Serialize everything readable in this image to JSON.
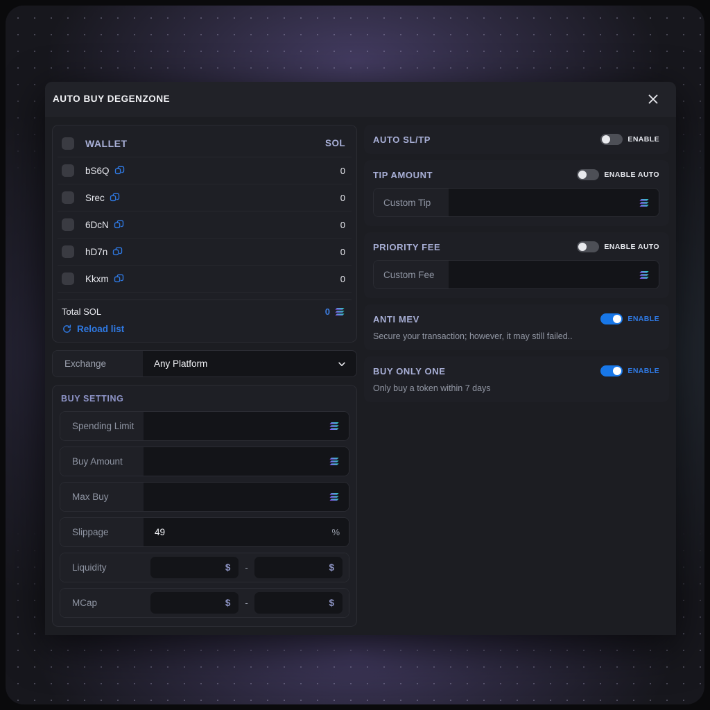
{
  "modal": {
    "title": "AUTO BUY DEGENZONE",
    "close_icon": "close-icon"
  },
  "wallet": {
    "header": {
      "name": "WALLET",
      "unit": "SOL"
    },
    "rows": [
      {
        "name": "bS6Q",
        "value": "0"
      },
      {
        "name": "Srec",
        "value": "0"
      },
      {
        "name": "6DcN",
        "value": "0"
      },
      {
        "name": "hD7n",
        "value": "0"
      },
      {
        "name": "Kkxm",
        "value": "0"
      }
    ],
    "total_label": "Total SOL",
    "total_value": "0",
    "reload_label": "Reload list",
    "reload_icon": "reload-icon",
    "copy_icon": "copy-icon",
    "sol_icon": "solana-icon"
  },
  "exchange": {
    "label": "Exchange",
    "value": "Any Platform",
    "chevron_icon": "chevron-down-icon"
  },
  "buy_setting": {
    "title": "BUY SETTING",
    "fields": [
      {
        "label": "Spending Limit",
        "value": "",
        "unit_icon": "solana-icon"
      },
      {
        "label": "Buy Amount",
        "value": "",
        "unit_icon": "solana-icon"
      },
      {
        "label": "Max Buy",
        "value": "",
        "unit_icon": "solana-icon"
      },
      {
        "label": "Slippage",
        "value": "49",
        "unit": "%"
      }
    ],
    "ranges": [
      {
        "label": "Liquidity",
        "min": "",
        "max": "",
        "currency": "$",
        "separator": "-"
      },
      {
        "label": "MCap",
        "min": "",
        "max": "",
        "currency": "$",
        "separator": "-"
      }
    ]
  },
  "right_panels": [
    {
      "title": "AUTO SL/TP",
      "toggle_label": "ENABLE",
      "toggle_on": false,
      "subtitle": "",
      "custom_field": null
    },
    {
      "title": "TIP AMOUNT",
      "toggle_label": "ENABLE AUTO",
      "toggle_on": false,
      "subtitle": "",
      "custom_field": {
        "label": "Custom Tip",
        "value": "",
        "unit_icon": "solana-icon"
      }
    },
    {
      "title": "PRIORITY FEE",
      "toggle_label": "ENABLE AUTO",
      "toggle_on": false,
      "subtitle": "",
      "custom_field": {
        "label": "Custom Fee",
        "value": "",
        "unit_icon": "solana-icon"
      }
    },
    {
      "title": "ANTI MEV",
      "toggle_label": "ENABLE",
      "toggle_on": true,
      "subtitle": "Secure your transaction; however, it may still failed..",
      "custom_field": null
    },
    {
      "title": "BUY ONLY ONE",
      "toggle_label": "ENABLE",
      "toggle_on": true,
      "subtitle": "Only buy a token within 7 days",
      "custom_field": null
    }
  ],
  "colors": {
    "accent_blue": "#2f7ae5",
    "toggle_on": "#1877e8",
    "panel_bg": "#1e1f25",
    "modal_bg": "#1c1d22",
    "heading": "#a8afd6",
    "sol_gradient_start": "#18e3b2",
    "sol_gradient_end": "#9945ff"
  }
}
